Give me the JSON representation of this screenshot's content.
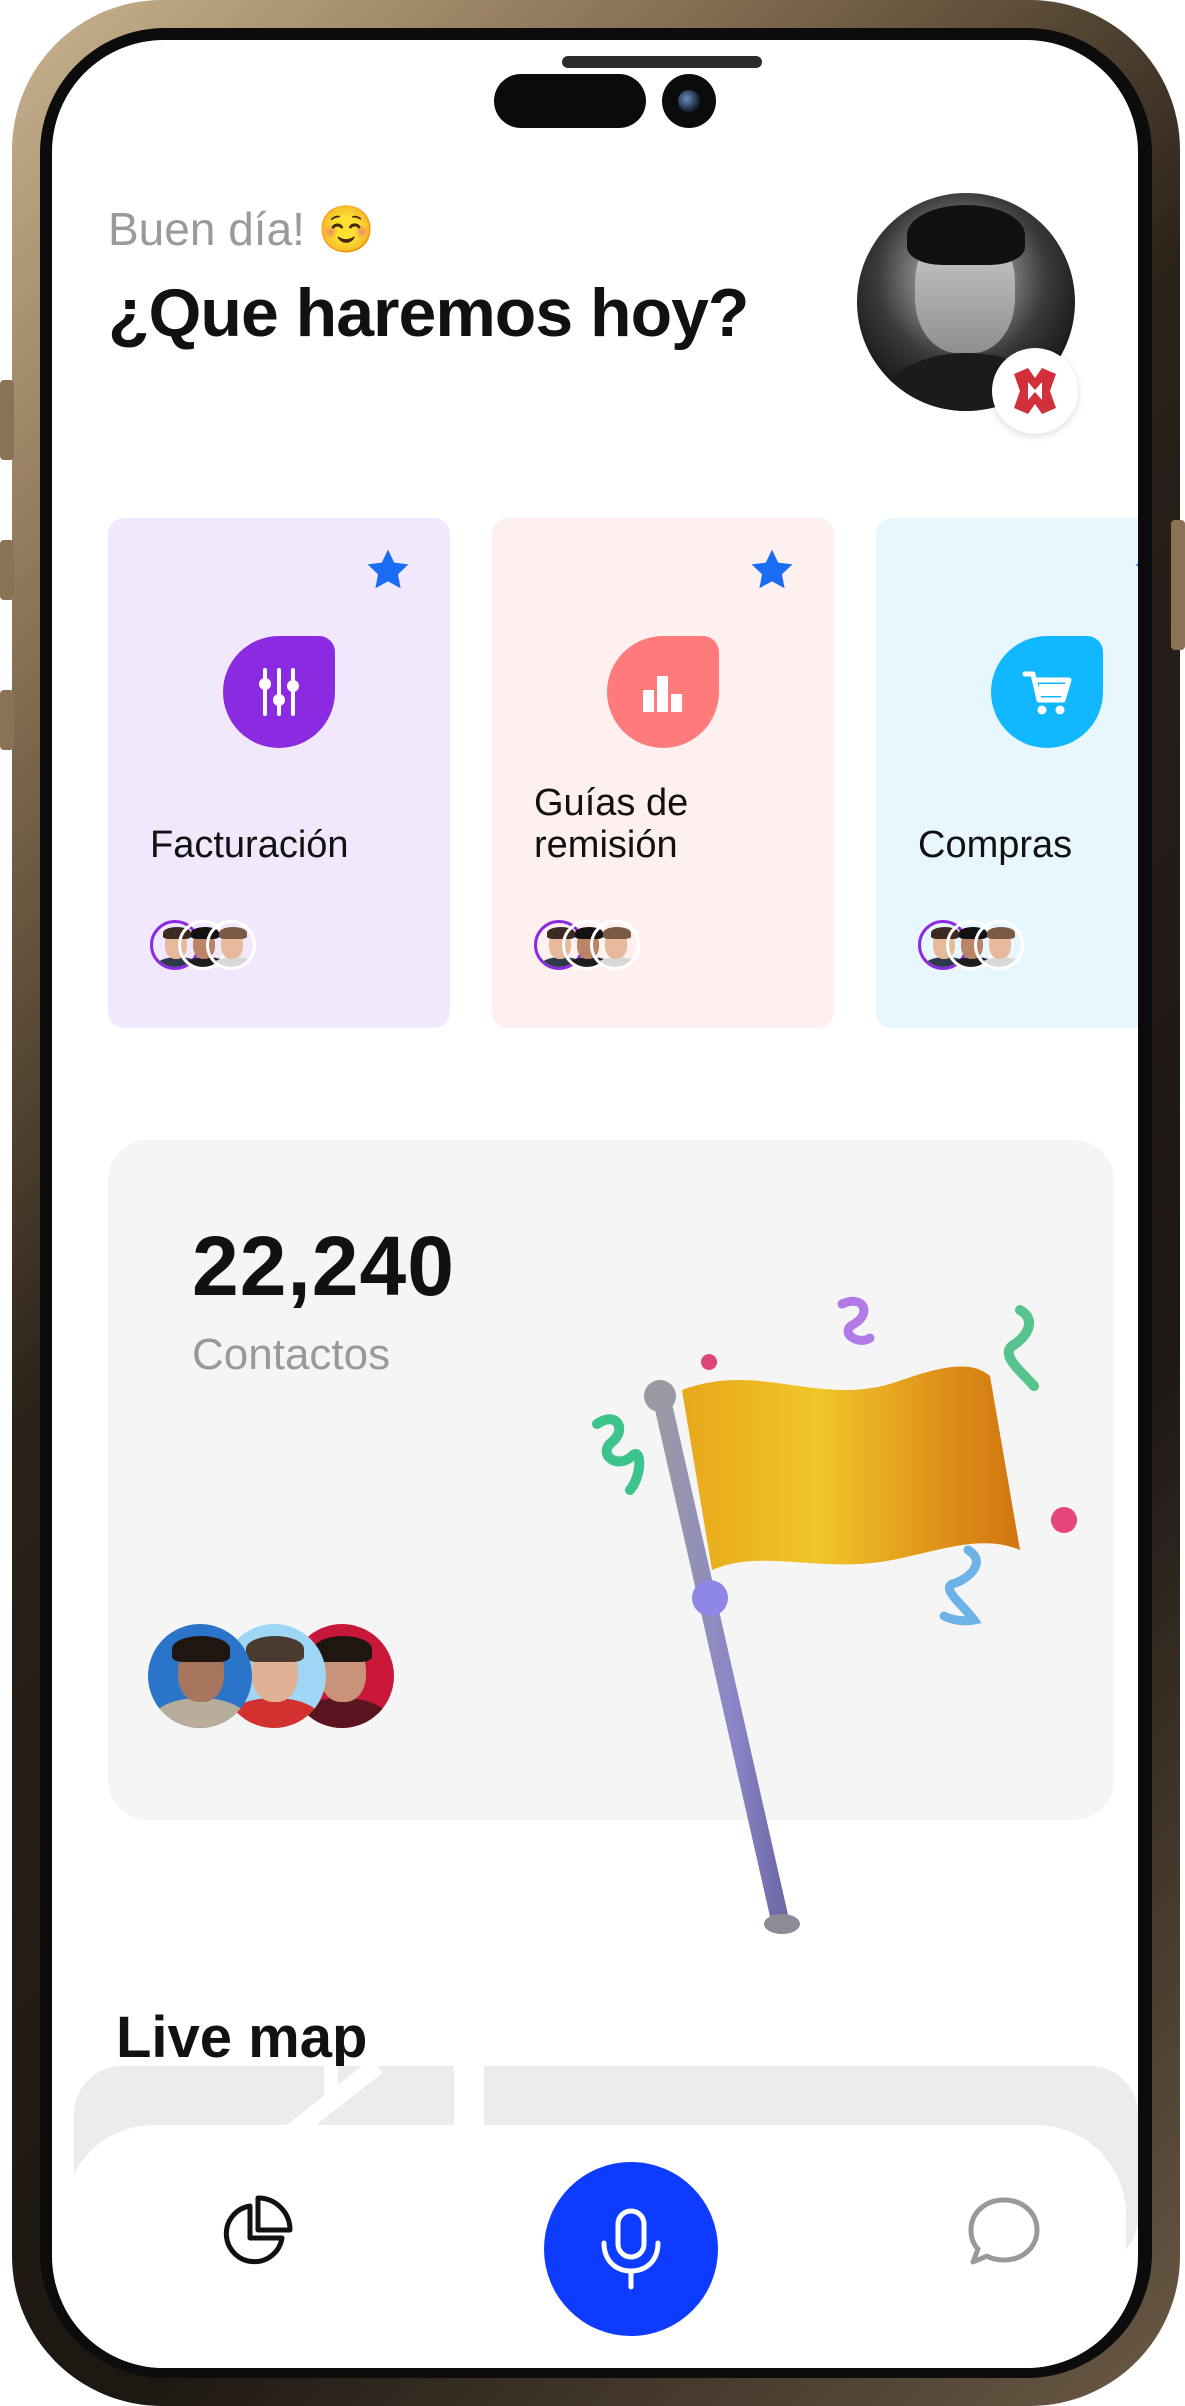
{
  "header": {
    "greeting": "Buen día! ☺️",
    "headline": "¿Que haremos hoy?"
  },
  "modules": [
    {
      "title": "Facturación",
      "icon": "sliders-icon",
      "bg": "#f1e8fd",
      "accent": "#8a2be2",
      "starred": true
    },
    {
      "title": "Guías de remisión",
      "title_line1": "Guías de",
      "title_line2": "remisión",
      "icon": "bar-chart-icon",
      "bg": "#fff0f0",
      "accent": "#ff7b7b",
      "starred": true
    },
    {
      "title": "Compras",
      "icon": "cart-icon",
      "bg": "#e8f7fd",
      "accent": "#12b8ff",
      "starred": true
    }
  ],
  "contacts": {
    "count": "22,240",
    "label": "Contactos"
  },
  "live_map": {
    "title": "Live map"
  },
  "nav": {
    "left_icon": "pie-chart-icon",
    "center_icon": "microphone-icon",
    "right_icon": "chat-bubble-icon"
  },
  "colors": {
    "primary": "#0d3bff",
    "star": "#1a6cf2"
  }
}
